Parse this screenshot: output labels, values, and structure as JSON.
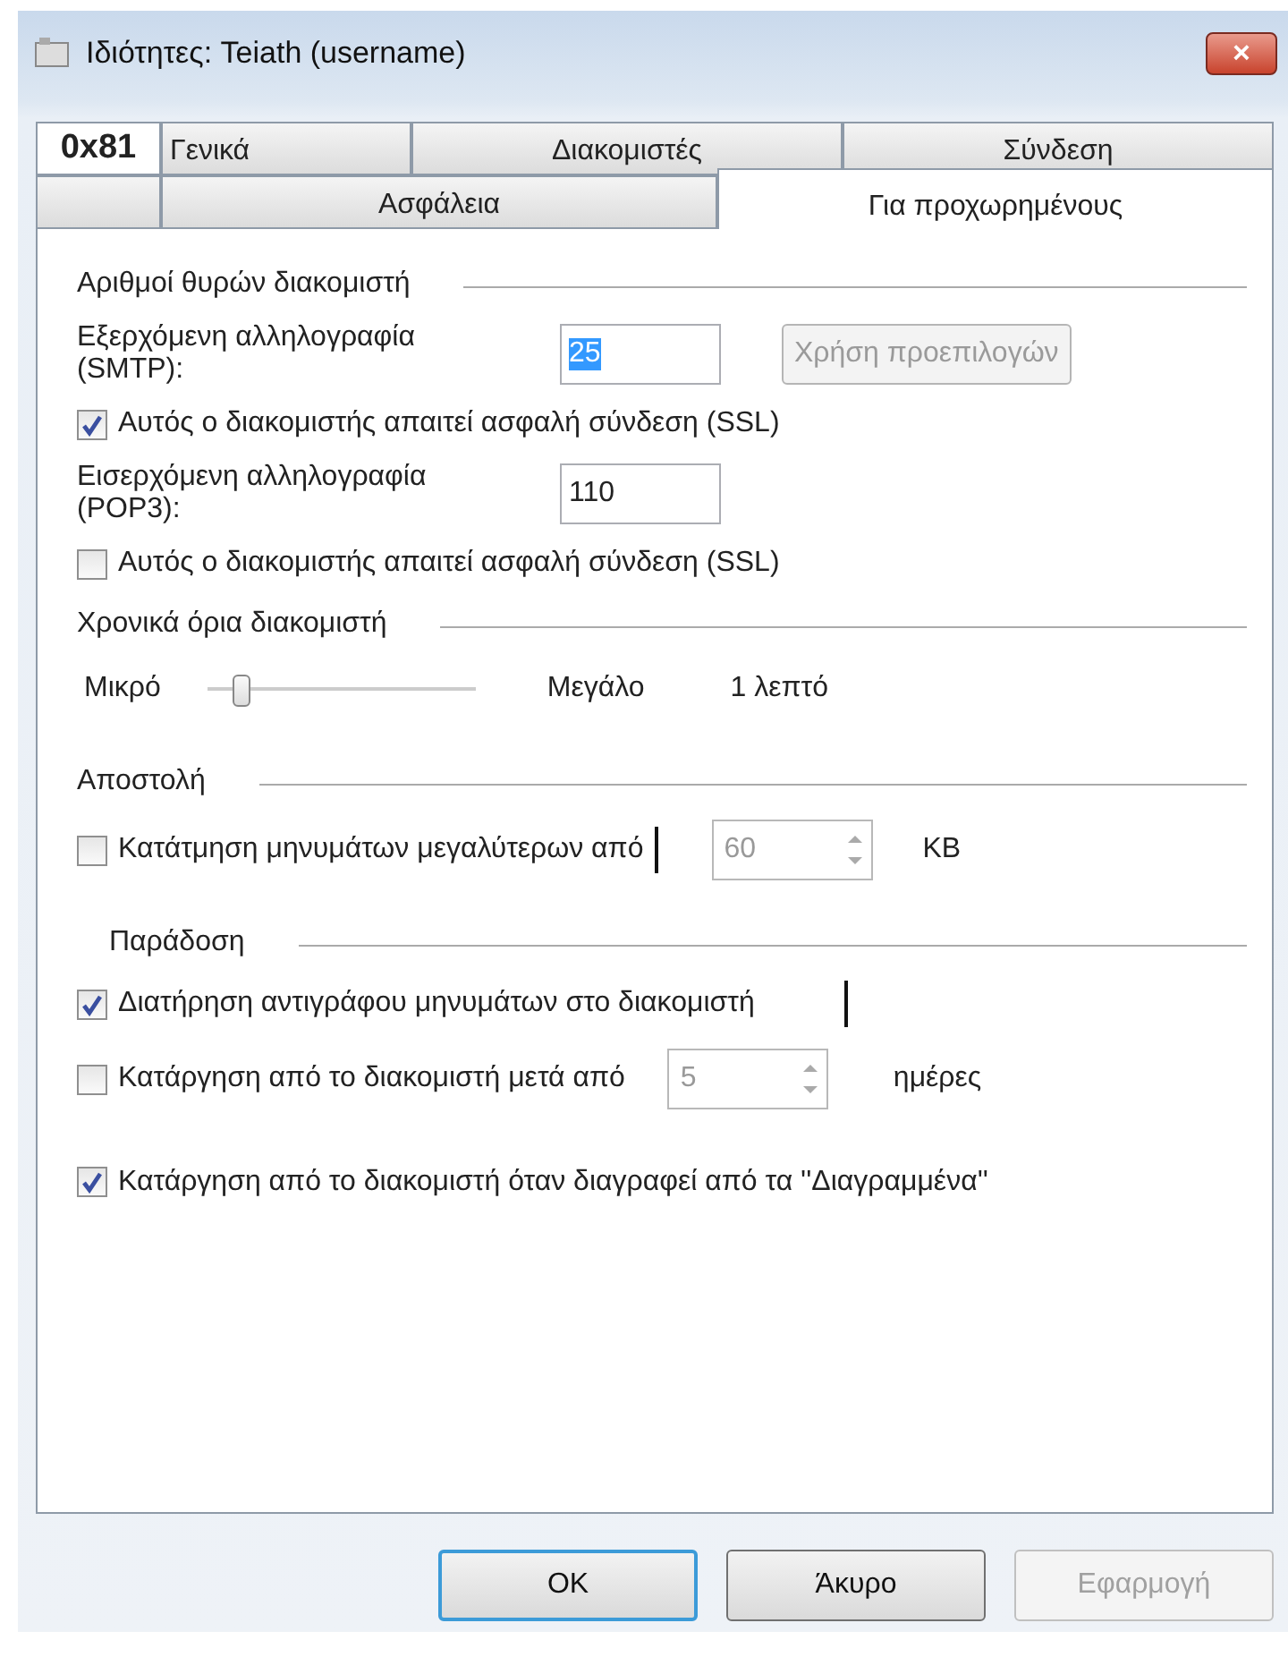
{
  "window": {
    "title": "Ιδιότητες: Teiath (username)",
    "close": "×"
  },
  "tab_rows": [
    {
      "tabs": [
        {
          "label": "0x81",
          "kind": "fragment",
          "selected": false
        },
        {
          "label": "Γενικά",
          "kind": "left",
          "selected": false
        },
        {
          "label": "Διακομιστές",
          "kind": "center",
          "selected": false
        },
        {
          "label": "Σύνδεση",
          "kind": "center",
          "selected": false
        }
      ]
    },
    {
      "tabs": [
        {
          "kind": "blank",
          "selected": false
        },
        {
          "label": "Ασφάλεια",
          "kind": "center",
          "selected": false
        },
        {
          "label": "Για προχωρημένους",
          "kind": "center",
          "selected": true
        }
      ]
    }
  ],
  "sections": [
    {
      "heading": "Αριθμοί θυρών διακομιστή",
      "items": [
        {
          "kind": "port",
          "label": "Εξερχόμενη αλληλογραφία (SMTP):",
          "value": "25",
          "value_selected": true,
          "button": "Χρήση προεπιλογών",
          "button_disabled": true
        },
        {
          "kind": "checkbox",
          "label": "Αυτός ο διακομιστής απαιτεί ασφαλή σύνδεση (SSL)",
          "checked": true
        },
        {
          "kind": "port",
          "label": "Εισερχόμενη αλληλογραφία (POP3):",
          "value": "110",
          "value_selected": false
        },
        {
          "kind": "checkbox",
          "label": "Αυτός ο διακομιστής απαιτεί ασφαλή σύνδεση (SSL)",
          "checked": false
        }
      ]
    },
    {
      "heading": "Χρονικά όρια διακομιστή",
      "items": [
        {
          "kind": "slider",
          "min_label": "Μικρό",
          "max_label": "Μεγάλο",
          "level": 0.13,
          "reading": "1 λεπτό"
        }
      ]
    },
    {
      "heading": "Αποστολή",
      "items": [
        {
          "kind": "spin",
          "label": "Κατάτμηση μηνυμάτων μεγαλύτερων από",
          "checked": false,
          "value": "60",
          "unit": "KB",
          "cursor": true
        }
      ]
    },
    {
      "heading": "Παράδοση",
      "indent": true,
      "items": [
        {
          "kind": "checkbox",
          "label": "Διατήρηση αντιγράφου μηνυμάτων στο διακομιστή",
          "checked": true,
          "cursor": true
        },
        {
          "kind": "spin",
          "label": "Κατάργηση από το διακομιστή μετά από",
          "checked": false,
          "value": "5",
          "unit": "ημέρες"
        },
        {
          "kind": "checkbox",
          "label": "Κατάργηση από το διακομιστή όταν διαγραφεί από τα ''Διαγραμμένα''",
          "checked": true,
          "wide": true
        }
      ]
    }
  ],
  "buttons": [
    {
      "label": "OK",
      "default": true,
      "disabled": false
    },
    {
      "label": "Άκυρο",
      "default": false,
      "disabled": false
    },
    {
      "label": "Εφαρμογή",
      "default": false,
      "disabled": true
    }
  ]
}
